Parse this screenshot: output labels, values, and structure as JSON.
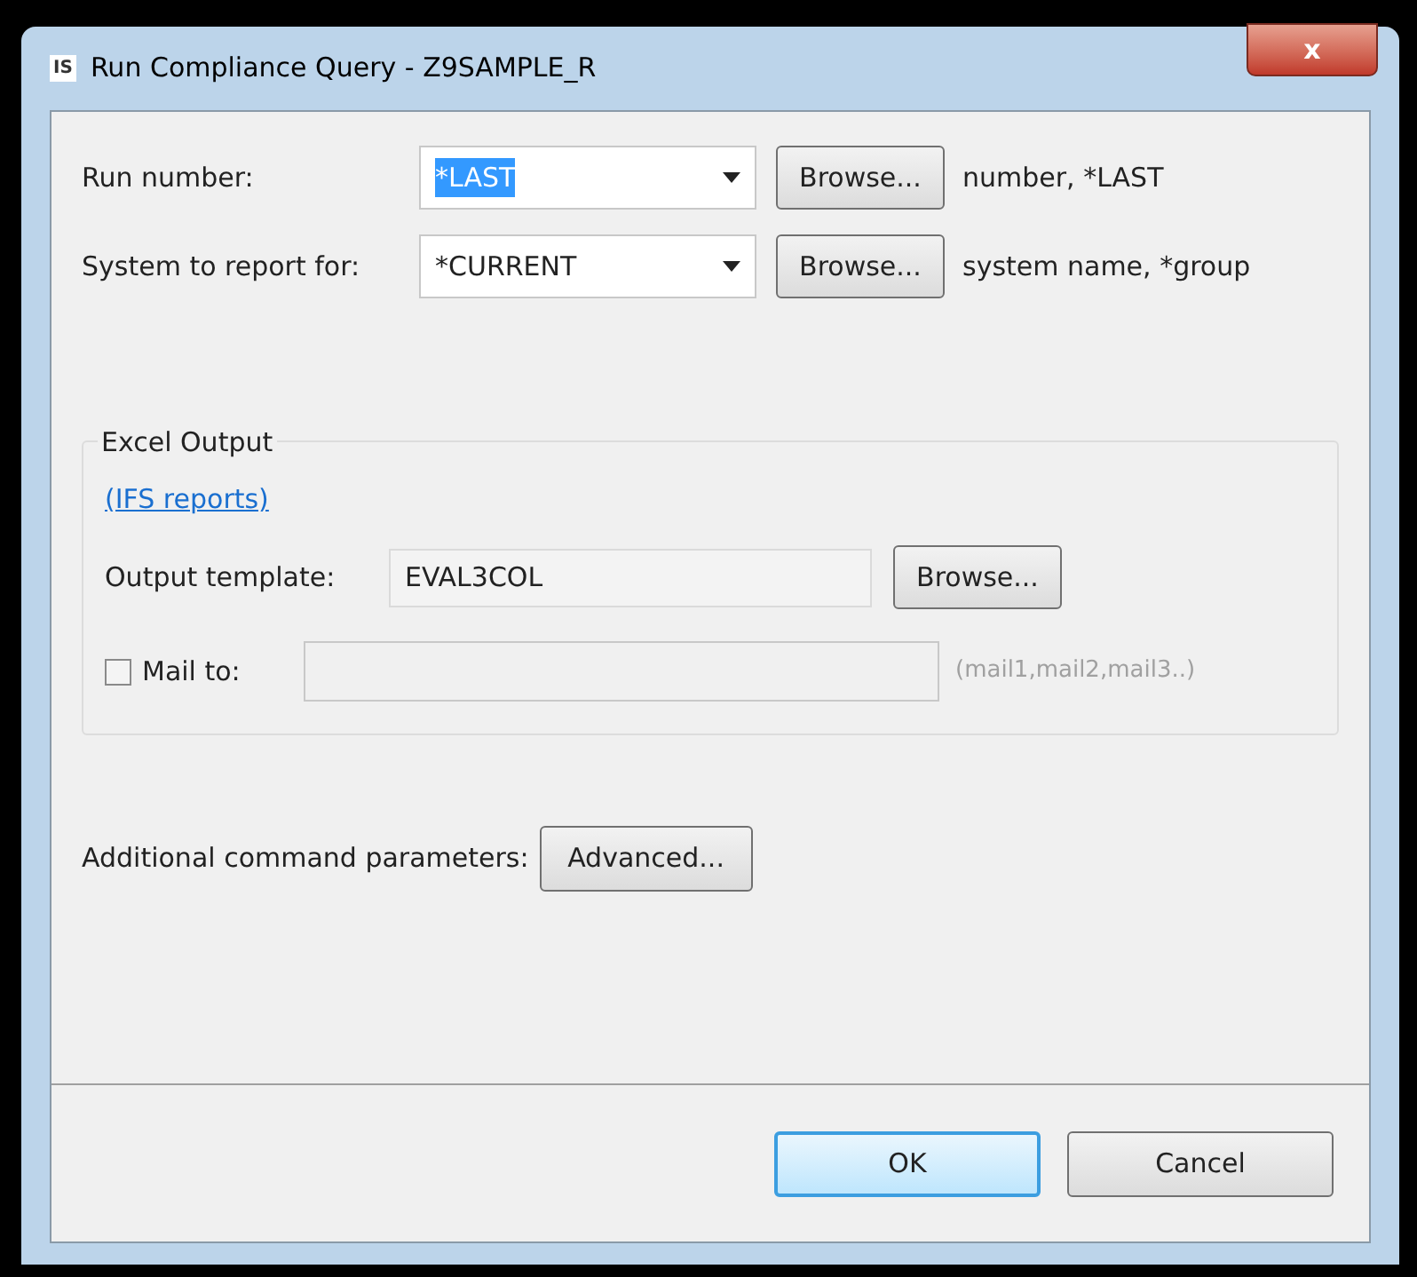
{
  "window": {
    "title": "Run Compliance Query - Z9SAMPLE_R",
    "app_icon": "IS",
    "close": "x"
  },
  "fields": [
    {
      "label": "Run number:",
      "value": "*LAST",
      "value_selected": true,
      "button": "Browse...",
      "hint": "number, *LAST"
    },
    {
      "label": "System to report for:",
      "value": "*CURRENT",
      "value_selected": false,
      "button": "Browse...",
      "hint": "system name, *group"
    }
  ],
  "excel_output": {
    "title": "Excel Output",
    "link": "(IFS reports)",
    "template_label": "Output template:",
    "template_value": "EVAL3COL",
    "template_button": "Browse...",
    "mail_label": "Mail to:",
    "mail_checked": false,
    "mail_hint": "(mail1,mail2,mail3..)"
  },
  "additional": {
    "label": "Additional command parameters:",
    "button": "Advanced..."
  },
  "buttons": [
    {
      "label": "OK",
      "default": true
    },
    {
      "label": "Cancel",
      "default": false
    }
  ]
}
